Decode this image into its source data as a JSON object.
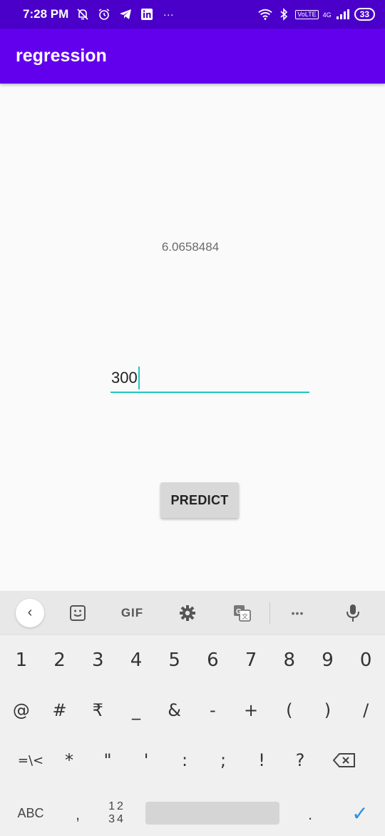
{
  "status_bar": {
    "time": "7:28 PM",
    "left_icons": [
      "mute-icon",
      "alarm-icon",
      "telegram-icon",
      "linkedin-icon",
      "more-dots-icon"
    ],
    "right_icons": [
      "wifi-icon",
      "bluetooth-icon",
      "volte-icon",
      "signal-icon"
    ],
    "volte_label": "VoLTE",
    "network_label": "4G",
    "battery": "33",
    "more": "···"
  },
  "app_bar": {
    "title": "regression"
  },
  "main": {
    "result": "6.0658484",
    "input_value": "300",
    "predict_label": "PREDICT"
  },
  "keyboard": {
    "toolbar": {
      "back": "‹",
      "gif": "GIF",
      "more": "•••"
    },
    "row_numbers": [
      "1",
      "2",
      "3",
      "4",
      "5",
      "6",
      "7",
      "8",
      "9",
      "0"
    ],
    "row_symbols1": [
      "@",
      "#",
      "₹",
      "_",
      "&",
      "-",
      "+",
      "(",
      ")",
      "/"
    ],
    "row_symbols2": [
      "=\\<",
      "*",
      "\"",
      "'",
      ":",
      ";",
      "!",
      "?"
    ],
    "abc": "ABC",
    "comma": ",",
    "nums_top": "12",
    "nums_bottom": "34",
    "period": ".",
    "enter": "✓"
  },
  "colors": {
    "status_bar": "#4a00c9",
    "app_bar": "#6200ee",
    "accent": "#1fc7c0"
  }
}
